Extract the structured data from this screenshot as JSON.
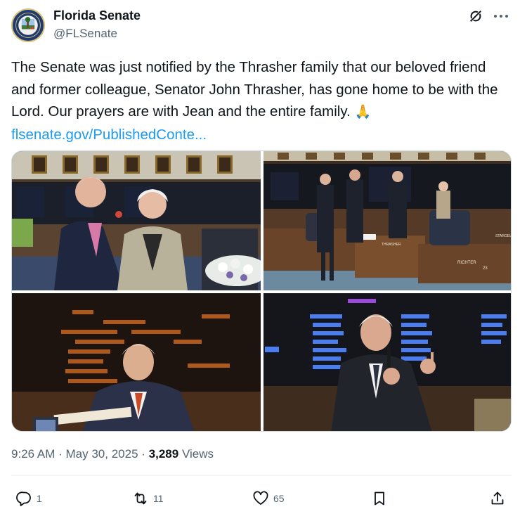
{
  "account": {
    "name": "Florida Senate",
    "handle": "@FLSenate",
    "avatar_icon": "florida-senate-seal"
  },
  "tweet": {
    "text": "The Senate was just notified by the Thrasher family that our beloved friend and former colleague, Senator John Thrasher, has gone home to be with the Lord. Our prayers are with Jean and the entire family.",
    "emoji": "🙏",
    "link": "flsenate.gov/PublishedConte..."
  },
  "media": {
    "photos": [
      {
        "icon": "photo-senator-with-spouse"
      },
      {
        "icon": "photo-senate-chamber-floor"
      },
      {
        "icon": "photo-senator-at-desk"
      },
      {
        "icon": "photo-senator-speaking"
      }
    ],
    "photo_text": {
      "desk_label_1": "THRASHER",
      "desk_label_2": "RICHTER",
      "desk_label_3": "STARGEL",
      "desk_number": "23"
    }
  },
  "meta": {
    "time": "9:26 AM",
    "date": "May 30, 2025",
    "views_count": "3,289",
    "views_label": "Views",
    "separator": "·"
  },
  "actions": {
    "reply_count": "1",
    "repost_count": "11",
    "like_count": "65"
  },
  "colors": {
    "link": "#1d9bf0",
    "secondary_text": "#536471",
    "primary_text": "#0f1419",
    "border": "#cfd9de"
  }
}
